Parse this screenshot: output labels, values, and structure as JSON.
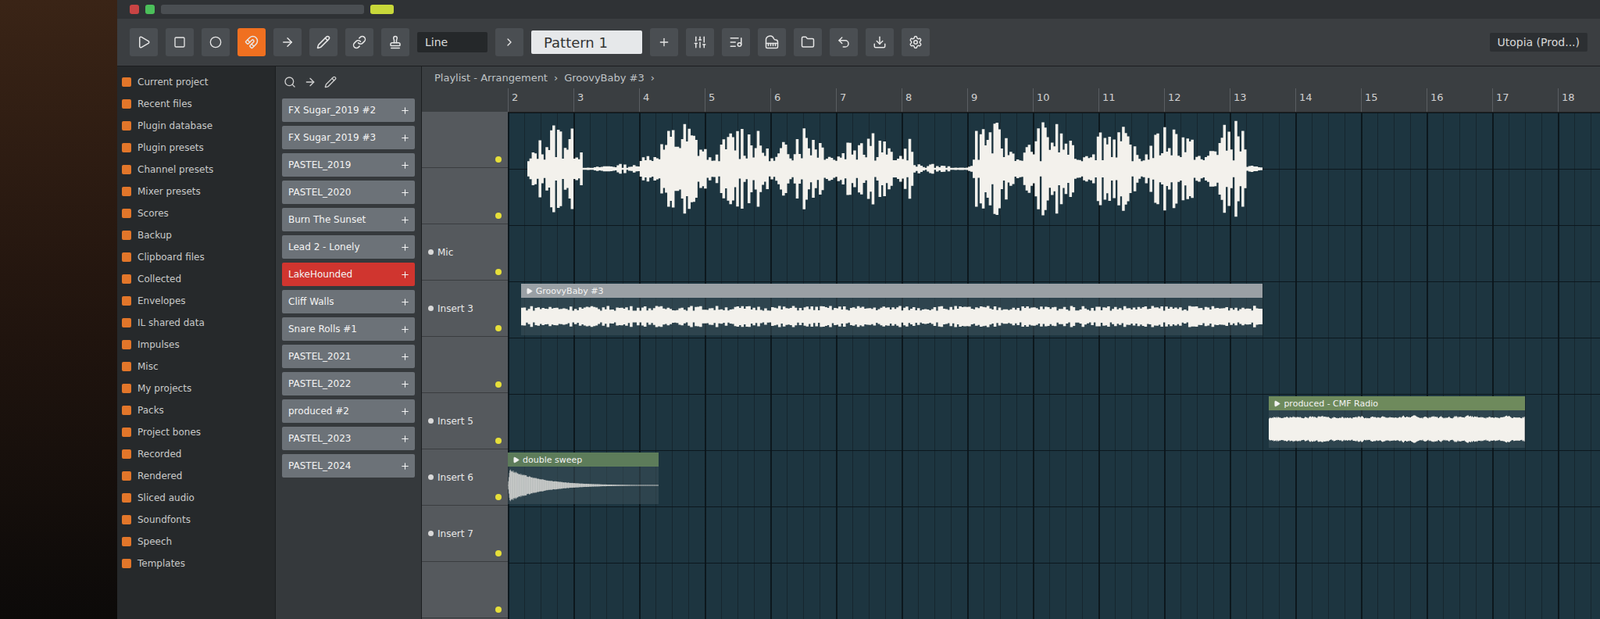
{
  "toolbar": {
    "snap": "Line",
    "pattern": "Pattern 1",
    "song": "Utopia (Prod...)"
  },
  "breadcrumb": {
    "items": [
      "Playlist - Arrangement",
      "GroovyBaby #3"
    ],
    "separator": "›"
  },
  "browser": {
    "items": [
      "Current project",
      "Recent files",
      "Plugin database",
      "Plugin presets",
      "Channel presets",
      "Mixer presets",
      "Scores",
      "Backup",
      "Clipboard files",
      "Collected",
      "Envelopes",
      "IL shared data",
      "Impulses",
      "Misc",
      "My projects",
      "Packs",
      "Project bones",
      "Recorded",
      "Rendered",
      "Sliced audio",
      "Soundfonts",
      "Speech",
      "Templates"
    ]
  },
  "patterns": [
    {
      "name": "FX Sugar_2019 #2",
      "selected": false
    },
    {
      "name": "FX Sugar_2019 #3",
      "selected": false
    },
    {
      "name": "PASTEL_2019",
      "selected": false
    },
    {
      "name": "PASTEL_2020",
      "selected": false
    },
    {
      "name": "Burn The Sunset",
      "selected": false
    },
    {
      "name": "Lead 2 - Lonely",
      "selected": false
    },
    {
      "name": "LakeHounded",
      "selected": true
    },
    {
      "name": "Cliff Walls",
      "selected": false
    },
    {
      "name": "Snare Rolls #1",
      "selected": false
    },
    {
      "name": "PASTEL_2021",
      "selected": false
    },
    {
      "name": "PASTEL_2022",
      "selected": false
    },
    {
      "name": "produced #2",
      "selected": false
    },
    {
      "name": "PASTEL_2023",
      "selected": false
    },
    {
      "name": "PASTEL_2024",
      "selected": false
    }
  ],
  "ruler": [
    "2",
    "3",
    "4",
    "5",
    "6",
    "7",
    "8",
    "9",
    "10",
    "11",
    "12",
    "13",
    "14",
    "15",
    "16",
    "17",
    "18"
  ],
  "tracks": [
    {
      "name": ""
    },
    {
      "name": ""
    },
    {
      "name": "Mic"
    },
    {
      "name": "Insert 3"
    },
    {
      "name": ""
    },
    {
      "name": "Insert 5"
    },
    {
      "name": "Insert 6"
    },
    {
      "name": "Insert 7"
    },
    {
      "name": ""
    }
  ],
  "clips": [
    {
      "name": "",
      "titled": false,
      "track": 0,
      "rows": 2,
      "start": 2.3,
      "length": 11.2,
      "color": "#000000",
      "kind": "vocal"
    },
    {
      "name": "GroovyBaby #3",
      "titled": true,
      "track": 3,
      "rows": 1,
      "start": 2.2,
      "length": 11.3,
      "color": "#9aa0a5",
      "kind": "dense"
    },
    {
      "name": "produced - CMF Radio",
      "titled": true,
      "track": 5,
      "rows": 1,
      "start": 13.6,
      "length": 3.9,
      "color": "#6e8a5c",
      "kind": "block"
    },
    {
      "name": "double sweep",
      "titled": true,
      "track": 6,
      "rows": 1,
      "start": 2.0,
      "length": 2.3,
      "color": "#5d7c5a",
      "kind": "sweep"
    }
  ]
}
